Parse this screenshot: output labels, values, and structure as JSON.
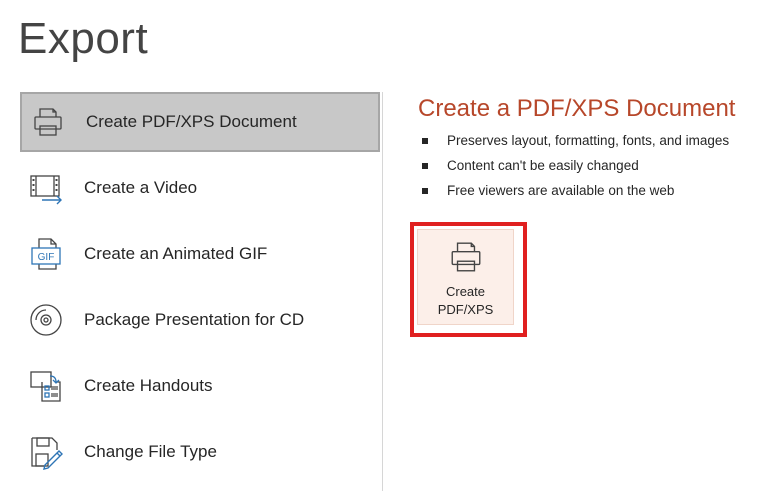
{
  "page": {
    "title": "Export"
  },
  "menu": {
    "items": [
      {
        "label": "Create PDF/XPS Document",
        "icon": "printer-icon",
        "selected": true
      },
      {
        "label": "Create a Video",
        "icon": "video-icon",
        "selected": false
      },
      {
        "label": "Create an Animated GIF",
        "icon": "gif-icon",
        "selected": false
      },
      {
        "label": "Package Presentation for CD",
        "icon": "cd-icon",
        "selected": false
      },
      {
        "label": "Create Handouts",
        "icon": "handouts-icon",
        "selected": false
      },
      {
        "label": "Change File Type",
        "icon": "change-file-type-icon",
        "selected": false
      }
    ]
  },
  "detail": {
    "title": "Create a PDF/XPS Document",
    "bullets": [
      "Preserves layout, formatting, fonts, and images",
      "Content can't be easily changed",
      "Free viewers are available on the web"
    ],
    "button": {
      "line1": "Create",
      "line2": "PDF/XPS",
      "icon": "printer-icon"
    }
  },
  "gif_icon_text": "GIF",
  "colors": {
    "accent": "#b7472a",
    "selected_bg": "#c8c8c8",
    "highlight": "#e02020",
    "button_bg": "#fcefe9"
  }
}
